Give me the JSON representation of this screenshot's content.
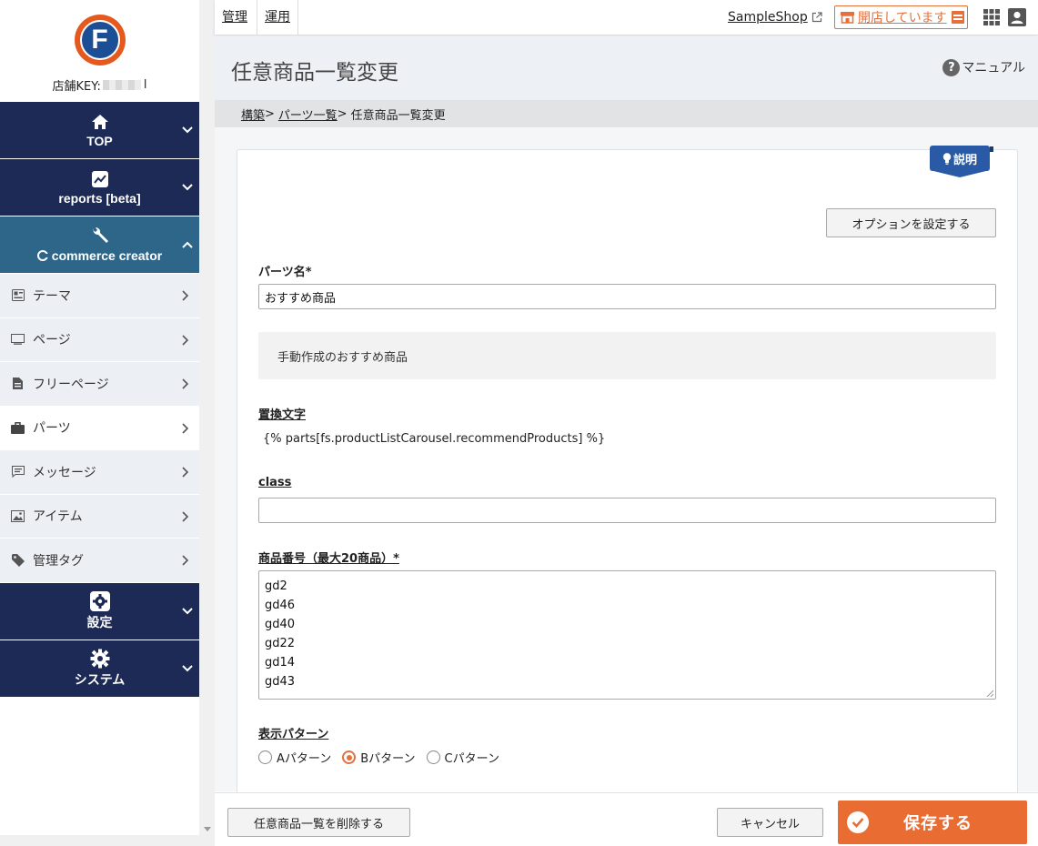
{
  "sidebar": {
    "store_key_label": "店舗KEY:",
    "store_key_tail": "l",
    "main_items": [
      {
        "label": "TOP",
        "icon": "home-icon"
      },
      {
        "label": "reports [beta]",
        "icon": "chart-icon"
      },
      {
        "label": "commerce creator",
        "icon": "wrench-icon"
      },
      {
        "label": "設定",
        "icon": "gear-icon"
      },
      {
        "label": "システム",
        "icon": "cog-icon"
      }
    ],
    "sub_items": [
      {
        "label": "テーマ",
        "icon": "theme-icon"
      },
      {
        "label": "ページ",
        "icon": "page-icon"
      },
      {
        "label": "フリーページ",
        "icon": "free-page-icon"
      },
      {
        "label": "パーツ",
        "icon": "briefcase-icon"
      },
      {
        "label": "メッセージ",
        "icon": "message-icon"
      },
      {
        "label": "アイテム",
        "icon": "image-icon"
      },
      {
        "label": "管理タグ",
        "icon": "tag-icon"
      }
    ]
  },
  "topbar": {
    "tab_admin": "管理",
    "tab_ops": "運用",
    "shop_link": "SampleShop",
    "open_status": "開店しています"
  },
  "header": {
    "title": "任意商品一覧変更",
    "manual": "マニュアル"
  },
  "breadcrumb": {
    "item1": "構築",
    "sep1": ">",
    "item2": "パーツ一覧",
    "sep2": ">",
    "current": "任意商品一覧変更"
  },
  "form": {
    "help_label": "説明",
    "options_button": "オプションを設定する",
    "parts_name_label": "パーツ名*",
    "parts_name_value": "おすすめ商品",
    "description": "手動作成のおすすめ商品",
    "replace_label": "置換文字",
    "replace_value": "{% parts[fs.productListCarousel.recommendProducts] %}",
    "class_label": "class",
    "class_value": "",
    "product_label": "商品番号（最大20商品）*",
    "product_numbers": [
      "gd2",
      "gd46",
      "gd40",
      "gd22",
      "gd14",
      "gd43"
    ],
    "pattern_label": "表示パターン",
    "patterns": [
      "Aパターン",
      "Bパターン",
      "Cパターン"
    ],
    "selected_pattern": "Bパターン"
  },
  "footer": {
    "delete_button": "任意商品一覧を削除する",
    "cancel_button": "キャンセル",
    "save_button": "保存する"
  },
  "colors": {
    "nav_dark": "#1c2a55",
    "nav_active": "#2e6689",
    "accent_orange": "#e96d32",
    "help_blue": "#2a5aa6"
  }
}
